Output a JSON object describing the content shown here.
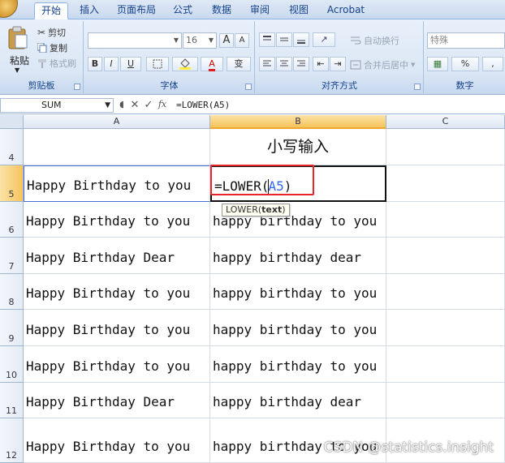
{
  "tabs": [
    "开始",
    "插入",
    "页面布局",
    "公式",
    "数据",
    "审阅",
    "视图",
    "Acrobat"
  ],
  "ribbon": {
    "clipboard": {
      "paste_label": "粘贴",
      "cut_label": "剪切",
      "copy_label": "复制",
      "format_painter_label": "格式刷",
      "group_label": "剪贴板"
    },
    "font": {
      "font_name": "",
      "font_size": "16",
      "bold": "B",
      "italic": "I",
      "underline": "U",
      "grow": "A",
      "shrink": "A",
      "font_color": "A",
      "phonetic": "变",
      "group_label": "字体"
    },
    "alignment": {
      "wrap_text_label": "自动换行",
      "merge_center_label": "合并后居中",
      "group_label": "对齐方式"
    },
    "number": {
      "format_value": "特殊",
      "percent": "%",
      "comma": ",",
      "group_label": "数字"
    }
  },
  "formula_bar": {
    "name_box": "SUM",
    "cancel": "✕",
    "enter": "✓",
    "fx": "fx",
    "formula": "=LOWER(A5)"
  },
  "sheet": {
    "columns": [
      "A",
      "B",
      "C"
    ],
    "rows": [
      "4",
      "5",
      "6",
      "7",
      "8",
      "9",
      "10",
      "11",
      "12"
    ],
    "header_title": "小写输入",
    "col_a": [
      "",
      "Happy Birthday to you",
      "Happy Birthday to you",
      "Happy Birthday Dear",
      "Happy Birthday to you",
      "Happy Birthday to you",
      "Happy Birthday to you",
      "Happy Birthday Dear",
      "Happy Birthday to you"
    ],
    "col_b": [
      "",
      "",
      "happy birthday to you",
      "happy birthday dear",
      "happy birthday to you",
      "happy birthday to you",
      "happy birthday to you",
      "happy birthday dear",
      "happy birthday to you"
    ],
    "editing_cell": {
      "prefix": "=LOWER(",
      "ref": "A5",
      "suffix": ")"
    }
  },
  "tooltip": {
    "func": "LOWER(",
    "arg": "text",
    "close": ")"
  },
  "watermark": "CSDN @statistics.insight"
}
